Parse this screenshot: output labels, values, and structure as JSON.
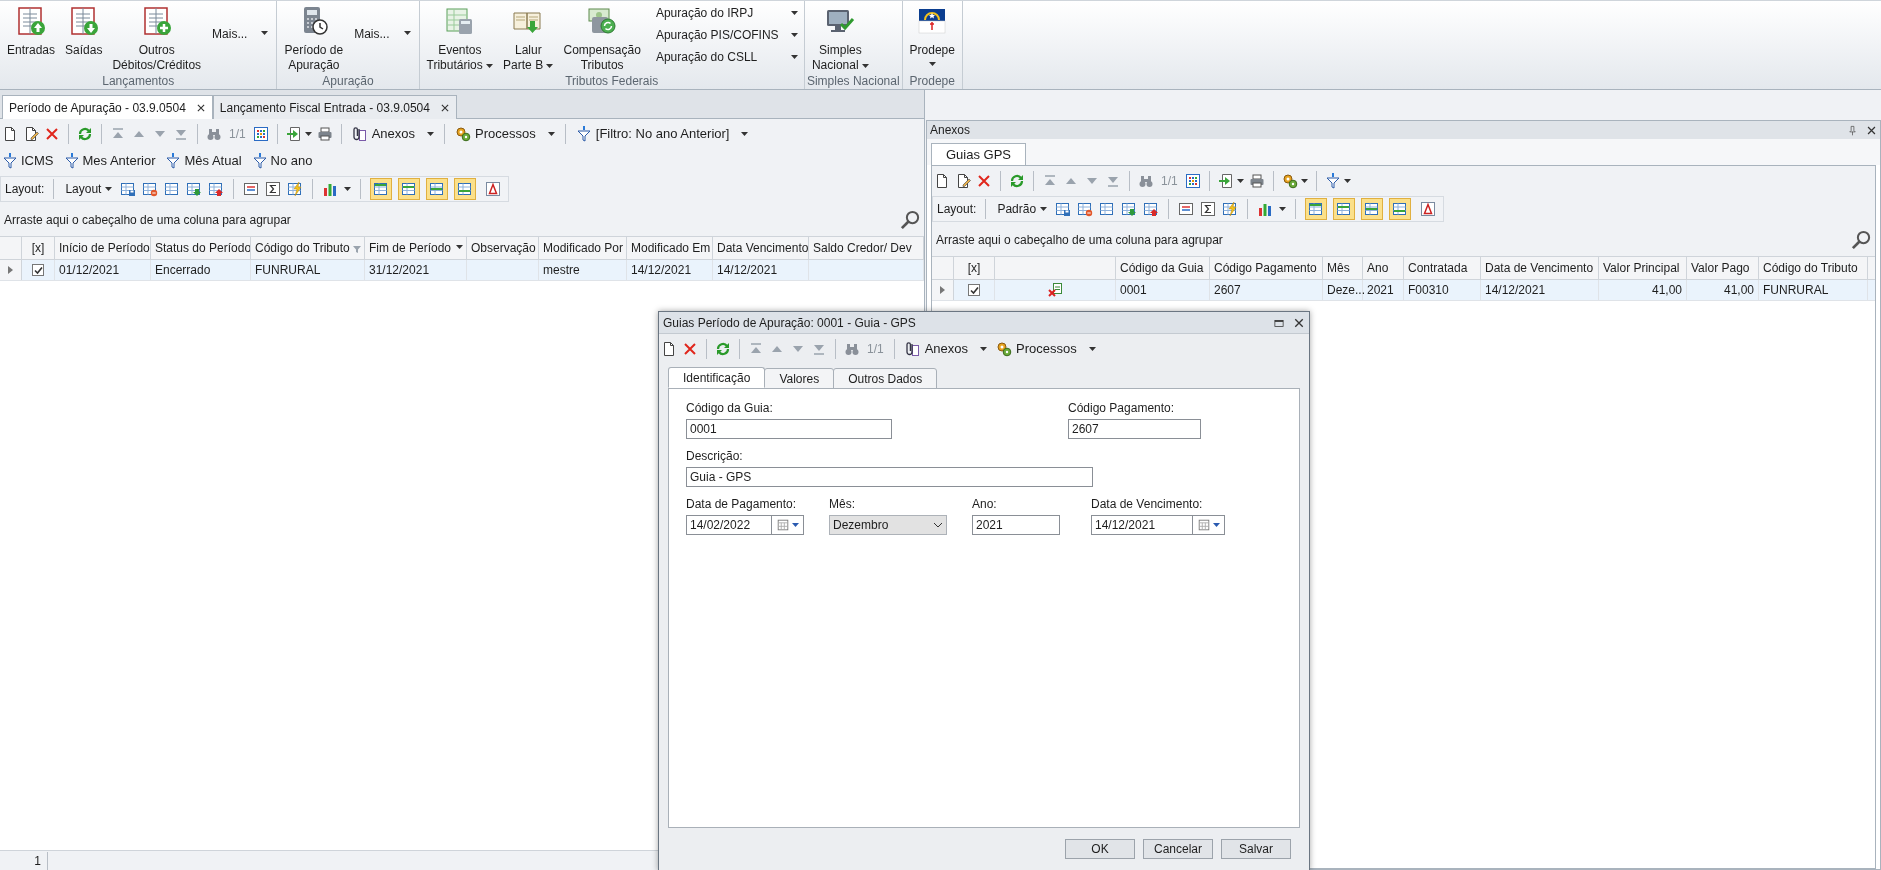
{
  "ribbon": {
    "groups": [
      {
        "label": "Lançamentos",
        "items": [
          {
            "kind": "large",
            "label": "Entradas",
            "dropdown": false
          },
          {
            "kind": "large",
            "label": "Saídas",
            "dropdown": false
          },
          {
            "kind": "large",
            "label": "Outros\nDébitos/Créditos",
            "dropdown": false
          },
          {
            "kind": "menu",
            "label": "Mais...",
            "dropdown": true
          }
        ]
      },
      {
        "label": "Apuração",
        "items": [
          {
            "kind": "large",
            "label": "Período de\nApuração",
            "dropdown": false
          },
          {
            "kind": "menu",
            "label": "Mais...",
            "dropdown": true
          }
        ]
      },
      {
        "label": "Tributos Federais",
        "items": [
          {
            "kind": "large",
            "label": "Eventos\nTributários",
            "dropdown": true
          },
          {
            "kind": "large",
            "label": "Lalur\nParte B",
            "dropdown": true
          },
          {
            "kind": "large",
            "label": "Compensação\nTributos",
            "dropdown": false
          },
          {
            "kind": "small",
            "label": "Apuração do IRPJ",
            "dropdown": true
          },
          {
            "kind": "small",
            "label": "Apuração PIS/COFINS",
            "dropdown": true
          },
          {
            "kind": "small",
            "label": "Apuração do CSLL",
            "dropdown": true
          }
        ]
      },
      {
        "label": "Simples Nacional",
        "items": [
          {
            "kind": "large",
            "label": "Simples\nNacional",
            "dropdown": true
          }
        ]
      },
      {
        "label": "Prodepe",
        "items": [
          {
            "kind": "large",
            "label": "Prodepe",
            "dropdown": true
          }
        ]
      }
    ]
  },
  "document_tabs": [
    {
      "label": "Período de Apuração - 03.9.0504",
      "selected": true
    },
    {
      "label": "Lançamento Fiscal Entrada - 03.9.0504",
      "selected": false
    }
  ],
  "main": {
    "toolbar": {
      "record_counter": "1/1",
      "menus": [
        "Anexos",
        "Processos",
        "[Filtro: No ano Anterior]"
      ]
    },
    "quick_filters": [
      "ICMS",
      "Mes Anterior",
      "Mês Atual",
      "No ano"
    ],
    "layout_bar": {
      "label": "Layout:",
      "layout": "Layout",
      "view_toggles": [
        {
          "on": true
        },
        {
          "on": true
        },
        {
          "on": true
        },
        {
          "on": true
        },
        {
          "on": false
        }
      ]
    },
    "group_hint": "Arraste aqui o cabeçalho de uma coluna para agrupar",
    "grid": {
      "columns": [
        {
          "kind": "check",
          "label": "[x]",
          "filtered": false,
          "sorted_descending": false
        },
        {
          "kind": "text",
          "label": "Início de Período",
          "filtered": false,
          "sorted_descending": false
        },
        {
          "kind": "text",
          "label": "Status do Período",
          "filtered": false,
          "sorted_descending": false
        },
        {
          "kind": "text",
          "label": "Código do Tributo",
          "filtered": true,
          "sorted_descending": false
        },
        {
          "kind": "text",
          "label": "Fim de Período",
          "filtered": false,
          "sorted_descending": true
        },
        {
          "kind": "text",
          "label": "Observação",
          "filtered": false,
          "sorted_descending": false
        },
        {
          "kind": "text",
          "label": "Modificado Por",
          "filtered": false,
          "sorted_descending": false
        },
        {
          "kind": "text",
          "label": "Modificado Em",
          "filtered": false,
          "sorted_descending": false
        },
        {
          "kind": "text",
          "label": "Data Vencimento",
          "filtered": false,
          "sorted_descending": false
        },
        {
          "kind": "text",
          "label": "Saldo Credor/ Dev",
          "filtered": false,
          "sorted_descending": false
        }
      ],
      "rows": [
        {
          "selected": true,
          "checked": true,
          "cells": [
            null,
            "01/12/2021",
            "Encerrado",
            "FUNRURAL",
            "31/12/2021",
            null,
            "mestre",
            "14/12/2021",
            "14/12/2021",
            null
          ]
        }
      ]
    },
    "status_bar": {
      "text": "1"
    }
  },
  "attachments_panel": {
    "title": "Anexos",
    "tabs": [
      {
        "label": "Guias GPS",
        "selected": true
      }
    ],
    "toolbar": {
      "record_counter": "1/1"
    },
    "layout_bar": {
      "label": "Layout:",
      "layout": "Padrão",
      "view_toggles": [
        {
          "on": true
        },
        {
          "on": true
        },
        {
          "on": true
        },
        {
          "on": true
        },
        {
          "on": false
        }
      ]
    },
    "group_hint": "Arraste aqui o cabeçalho de uma coluna para agrupar",
    "grid": {
      "columns": [
        {
          "kind": "check",
          "label": "[x]"
        },
        {
          "kind": "icon"
        },
        {
          "kind": "text",
          "label": "Código da Guia"
        },
        {
          "kind": "text",
          "label": "Código Pagamento"
        },
        {
          "kind": "text",
          "label": "Mês"
        },
        {
          "kind": "text",
          "label": "Ano"
        },
        {
          "kind": "text",
          "label": "Contratada"
        },
        {
          "kind": "text",
          "label": "Data de Vencimento"
        },
        {
          "kind": "number",
          "label": "Valor Principal"
        },
        {
          "kind": "number",
          "label": "Valor Pago"
        },
        {
          "kind": "text",
          "label": "Código do Tributo"
        }
      ],
      "rows": [
        {
          "selected": true,
          "checked": true,
          "cells": [
            null,
            null,
            "0001",
            "2607",
            "Deze...",
            "2021",
            "F00310",
            "14/12/2021",
            "41,00",
            "41,00",
            "FUNRURAL"
          ]
        }
      ]
    }
  },
  "dialog": {
    "title": "Guias Período de Apuração: 0001 - Guia - GPS",
    "toolbar": {
      "record_counter": "1/1",
      "menus": [
        "Anexos",
        "Processos"
      ]
    },
    "tabs": [
      {
        "label": "Identificação",
        "selected": true
      },
      {
        "label": "Valores",
        "selected": false
      },
      {
        "label": "Outros Dados",
        "selected": false
      }
    ],
    "field_rows": [
      [
        {
          "kind": "text",
          "label": "Código da Guia:",
          "value": "0001"
        },
        {
          "kind": "text",
          "label": "Código Pagamento:",
          "value": "2607"
        }
      ],
      [
        {
          "kind": "text",
          "label": "Descrição:",
          "value": "Guia - GPS"
        }
      ],
      [
        {
          "kind": "date",
          "label": "Data de Pagamento:",
          "value": "14/02/2022"
        },
        {
          "kind": "select",
          "label": "Mês:",
          "value": "Dezembro"
        },
        {
          "kind": "text",
          "label": "Ano:",
          "value": "2021"
        },
        {
          "kind": "date",
          "label": "Data de Vencimento:",
          "value": "14/12/2021"
        }
      ]
    ],
    "buttons": [
      "OK",
      "Cancelar",
      "Salvar"
    ]
  }
}
